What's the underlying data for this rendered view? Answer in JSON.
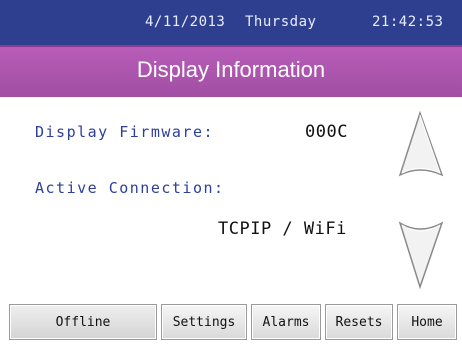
{
  "status_bar": {
    "date": "4/11/2013",
    "weekday": "Thursday",
    "time": "21:42:53"
  },
  "header": {
    "title": "Display Information"
  },
  "info": {
    "firmware_label": "Display Firmware:",
    "firmware_value": "000C",
    "connection_label": "Active Connection:",
    "connection_value": "TCPIP / WiFi"
  },
  "icons": {
    "scroll_up": "chevron-up-icon",
    "scroll_down": "chevron-down-icon"
  },
  "toolbar": {
    "buttons": [
      {
        "label": "Offline"
      },
      {
        "label": "Settings"
      },
      {
        "label": "Alarms"
      },
      {
        "label": "Resets"
      },
      {
        "label": "Home"
      }
    ]
  },
  "colors": {
    "status_bar": "#2e3f8f",
    "title_bar": "#a14ea4",
    "label_text": "#2d3f9a"
  }
}
